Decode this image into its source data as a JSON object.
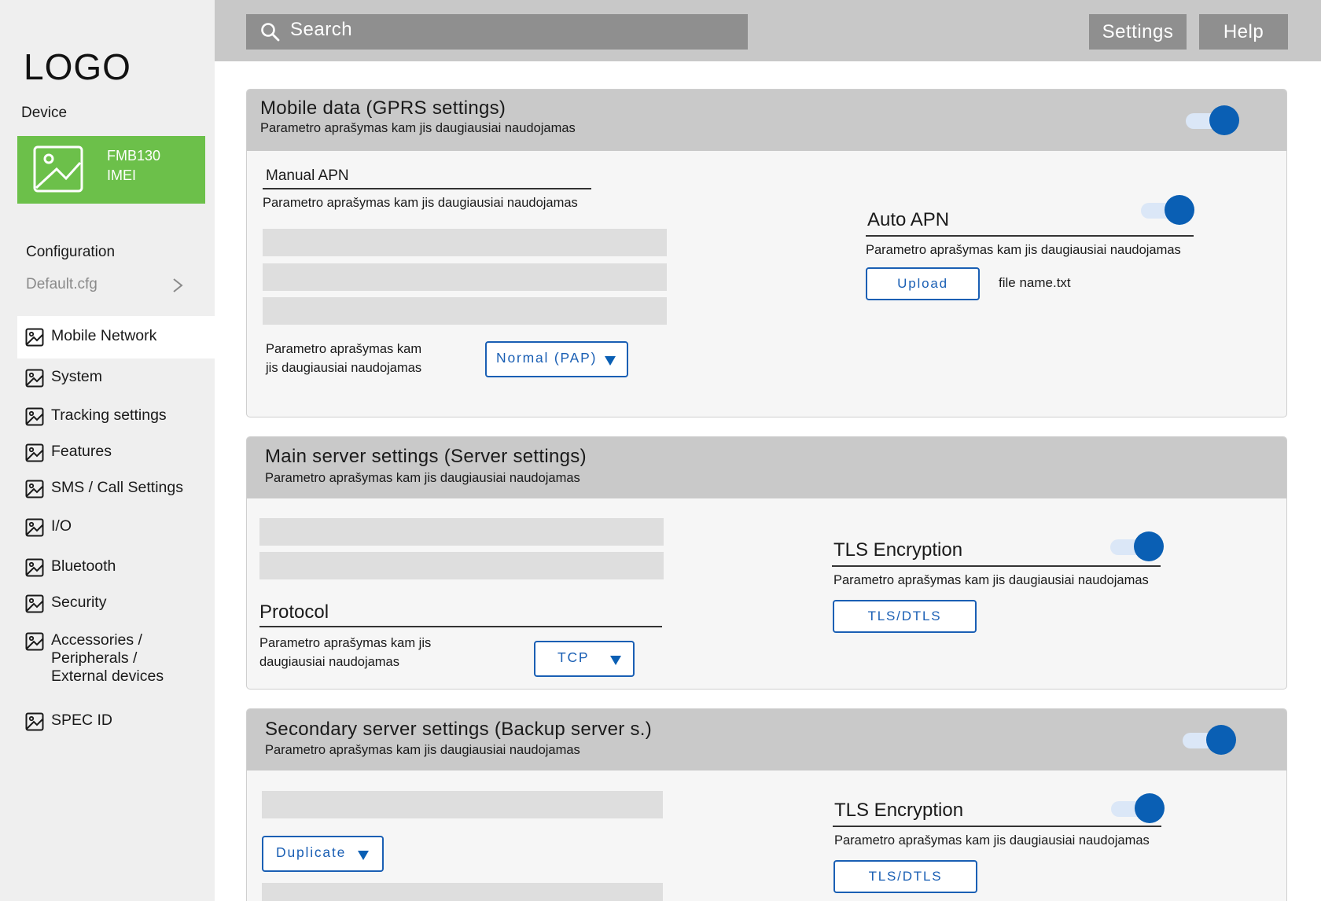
{
  "sidebar": {
    "logo": "LOGO",
    "device_label": "Device",
    "device": {
      "model": "FMB130",
      "imei": "IMEI",
      "icon": "image-icon",
      "color": "#6cc04a"
    },
    "configuration_label": "Configuration",
    "config_file": "Default.cfg",
    "nav_items": [
      {
        "label": "Mobile Network",
        "icon": "image-icon",
        "active": true
      },
      {
        "label": "System",
        "icon": "image-icon",
        "active": false
      },
      {
        "label": "Tracking settings",
        "icon": "image-icon",
        "active": false
      },
      {
        "label": "Features",
        "icon": "image-icon",
        "active": false
      },
      {
        "label": "SMS / Call Settings",
        "icon": "image-icon",
        "active": false
      },
      {
        "label": "I/O",
        "icon": "image-icon",
        "active": false
      },
      {
        "label": "Bluetooth",
        "icon": "image-icon",
        "active": false
      },
      {
        "label": "Security",
        "icon": "image-icon",
        "active": false
      },
      {
        "label_lines": [
          "Accessories /",
          "Peripherals /",
          "External devices"
        ],
        "icon": "image-icon",
        "active": false
      },
      {
        "label": "SPEC ID",
        "icon": "image-icon",
        "active": false
      }
    ]
  },
  "topbar": {
    "search_placeholder": "Search",
    "settings_label": "Settings",
    "help_label": "Help"
  },
  "colors": {
    "accent": "#0a5fb4",
    "toggle_track": "#dbe7f7",
    "device_card": "#6cc04a",
    "header_bg": "#c9c9c9"
  },
  "gprs": {
    "title": "Mobile data (GPRS settings)",
    "description": "Parametro aprašymas kam jis daugiausiai naudojamas",
    "enabled": true,
    "manual_apn": {
      "title": "Manual APN",
      "description": "Parametro aprašymas kam jis daugiausiai naudojamas",
      "auth_description_lines": [
        "Parametro aprašymas kam",
        "jis daugiausiai naudojamas"
      ],
      "auth_value": "Normal (PAP)"
    },
    "auto_apn": {
      "title": "Auto APN",
      "enabled": true,
      "description": "Parametro aprašymas kam jis daugiausiai naudojamas",
      "upload_label": "Upload",
      "file_name": "file name.txt"
    }
  },
  "main_server": {
    "title": "Main server settings (Server settings)",
    "description": "Parametro aprašymas kam jis daugiausiai naudojamas",
    "protocol": {
      "title": "Protocol",
      "description_lines": [
        "Parametro aprašymas kam jis",
        "daugiausiai naudojamas"
      ],
      "value": "TCP"
    },
    "tls": {
      "title": "TLS Encryption",
      "enabled": true,
      "description": "Parametro aprašymas kam jis daugiausiai naudojamas",
      "button_label": "TLS/DTLS"
    }
  },
  "secondary_server": {
    "title": "Secondary server settings (Backup server s.)",
    "description": "Parametro aprašymas kam jis daugiausiai naudojamas",
    "enabled": true,
    "mode_value": "Duplicate",
    "tls": {
      "title": "TLS Encryption",
      "enabled": true,
      "description": "Parametro aprašymas kam jis daugiausiai naudojamas",
      "button_label": "TLS/DTLS"
    }
  }
}
